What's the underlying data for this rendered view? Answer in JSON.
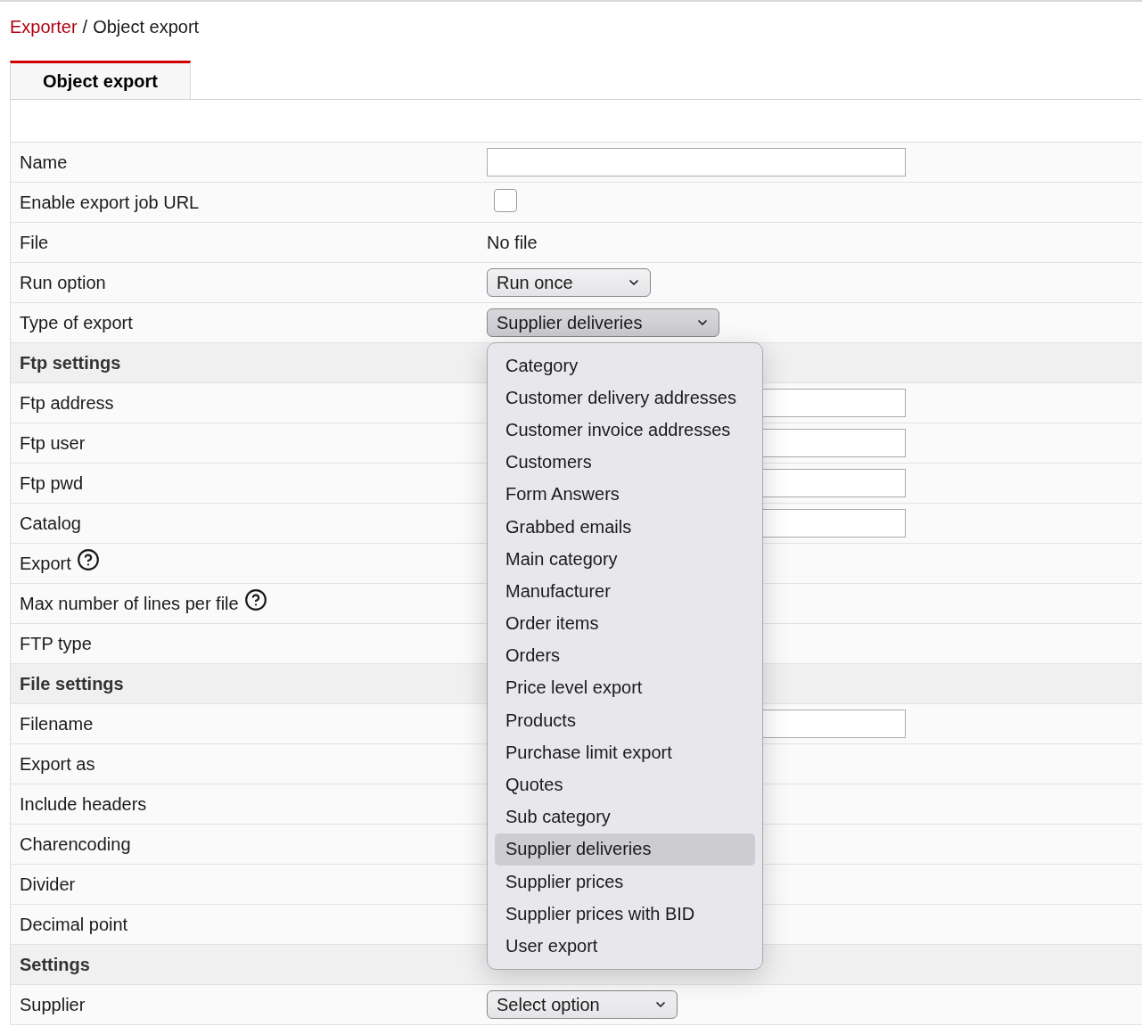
{
  "breadcrumb": {
    "link": "Exporter",
    "separator": "/",
    "current": "Object export"
  },
  "tabs": [
    {
      "label": "Object export",
      "selected": true
    }
  ],
  "rows": [
    {
      "kind": "field",
      "label": "Name",
      "control": {
        "kind": "input"
      }
    },
    {
      "kind": "field",
      "label": "Enable export job URL",
      "control": {
        "kind": "checkbox",
        "checked": false
      }
    },
    {
      "kind": "field",
      "label": "File",
      "control": {
        "kind": "text",
        "value": "No file"
      }
    },
    {
      "kind": "field",
      "label": "Run option",
      "control": {
        "kind": "select",
        "value": "Run once",
        "open": false
      }
    },
    {
      "kind": "field",
      "label": "Type of export",
      "control": {
        "kind": "select",
        "value": "Supplier deliveries",
        "open": true,
        "options": [
          {
            "label": "Category",
            "selected": false
          },
          {
            "label": "Customer delivery addresses",
            "selected": false
          },
          {
            "label": "Customer invoice addresses",
            "selected": false
          },
          {
            "label": "Customers",
            "selected": false
          },
          {
            "label": "Form Answers",
            "selected": false
          },
          {
            "label": "Grabbed emails",
            "selected": false
          },
          {
            "label": "Main category",
            "selected": false
          },
          {
            "label": "Manufacturer",
            "selected": false
          },
          {
            "label": "Order items",
            "selected": false
          },
          {
            "label": "Orders",
            "selected": false
          },
          {
            "label": "Price level export",
            "selected": false
          },
          {
            "label": "Products",
            "selected": false
          },
          {
            "label": "Purchase limit export",
            "selected": false
          },
          {
            "label": "Quotes",
            "selected": false
          },
          {
            "label": "Sub category",
            "selected": false
          },
          {
            "label": "Supplier deliveries",
            "selected": true
          },
          {
            "label": "Supplier prices",
            "selected": false
          },
          {
            "label": "Supplier prices with BID",
            "selected": false
          },
          {
            "label": "User export",
            "selected": false
          }
        ]
      }
    },
    {
      "kind": "section",
      "label": "Ftp settings"
    },
    {
      "kind": "field",
      "label": "Ftp address",
      "control": {
        "kind": "input"
      }
    },
    {
      "kind": "field",
      "label": "Ftp user",
      "control": {
        "kind": "input"
      }
    },
    {
      "kind": "field",
      "label": "Ftp pwd",
      "control": {
        "kind": "input"
      }
    },
    {
      "kind": "field",
      "label": "Catalog",
      "control": {
        "kind": "input"
      }
    },
    {
      "kind": "field",
      "label": "Export",
      "help": true
    },
    {
      "kind": "field",
      "label": "Max number of lines per file",
      "help": true
    },
    {
      "kind": "field",
      "label": "FTP type"
    },
    {
      "kind": "section",
      "label": "File settings"
    },
    {
      "kind": "field",
      "label": "Filename",
      "control": {
        "kind": "input"
      }
    },
    {
      "kind": "field",
      "label": "Export as"
    },
    {
      "kind": "field",
      "label": "Include headers"
    },
    {
      "kind": "field",
      "label": "Charencoding"
    },
    {
      "kind": "field",
      "label": "Divider"
    },
    {
      "kind": "field",
      "label": "Decimal point"
    },
    {
      "kind": "section",
      "label": "Settings"
    },
    {
      "kind": "field",
      "label": "Supplier",
      "control": {
        "kind": "select",
        "value": "Select option",
        "open": false
      }
    }
  ]
}
